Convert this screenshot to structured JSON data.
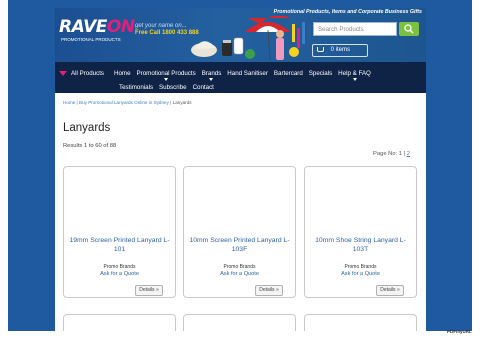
{
  "header": {
    "tagline": "Promotional Products, Items and Corporate Business Gifts",
    "logo_main": "RAVE",
    "logo_accent": "ON",
    "logo_sub": "PROMOTIONAL PRODUCTS",
    "promo_line1": "get your name on...",
    "promo_line2": "Free Call 1800 433 888",
    "search_placeholder": "Search Products",
    "search_icon": "magnifier-icon",
    "cart_label": "0 items",
    "cart_icon": "basket-icon"
  },
  "nav": {
    "all_products": "All Products",
    "items_row1": [
      "Home",
      "Promotional Products",
      "Brands",
      "Hand Sanitiser",
      "Bartercard",
      "Specials",
      "Help & FAQ"
    ],
    "items_row2": [
      "Testimonials",
      "Subscribe",
      "Contact"
    ]
  },
  "breadcrumb": {
    "home": "Home",
    "sep1": " | ",
    "parent": "Buy Promotional Lanyards Online in Sydney",
    "sep2": " | ",
    "current": "Lanyards"
  },
  "page_title": "Lanyards",
  "results_text": "Results 1 to 60 of 88",
  "pager": {
    "label": "Page No:",
    "page1": "1",
    "sep": "|",
    "page2": "2"
  },
  "products": [
    {
      "title": "19mm Screen Printed Lanyard L-101",
      "brand": "Promo Brands",
      "quote": "Ask for a Quote",
      "details": "Details »"
    },
    {
      "title": "10mm Screen Printed Lanyard L-103F",
      "brand": "Promo Brands",
      "quote": "Ask for a Quote",
      "details": "Details »"
    },
    {
      "title": "10mm Shoe String Lanyard L-103T",
      "brand": "Promo Brands",
      "quote": "Ask for a Quote",
      "details": "Details »"
    }
  ],
  "footer_badge": "PDFmyURL",
  "colors": {
    "page_bg": "#1f5aa0",
    "nav_bg": "#0f2347",
    "accent": "#e0207a",
    "link": "#2e63a8",
    "search_btn": "#7dc142"
  }
}
